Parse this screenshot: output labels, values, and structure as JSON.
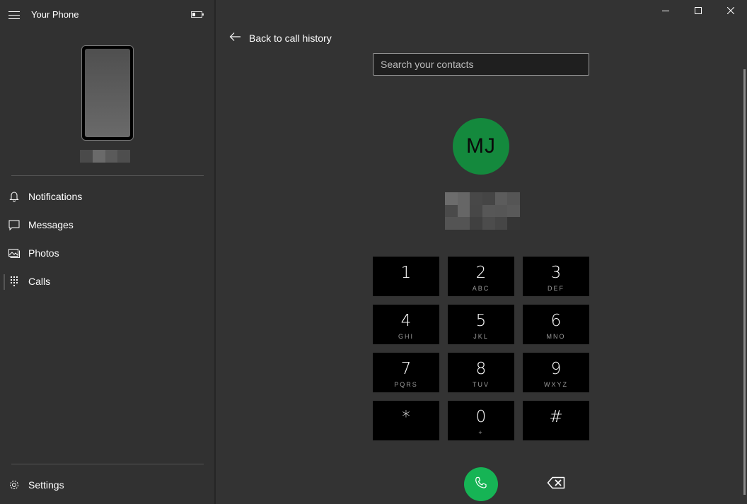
{
  "app": {
    "title": "Your Phone",
    "battery_level": 0.25
  },
  "sidebar": {
    "menu_icon": "hamburger-icon",
    "items": [
      {
        "label": "Notifications",
        "icon": "bell-icon",
        "active": false
      },
      {
        "label": "Messages",
        "icon": "chat-bubble-icon",
        "active": false
      },
      {
        "label": "Photos",
        "icon": "photos-icon",
        "active": false
      },
      {
        "label": "Calls",
        "icon": "dialpad-icon",
        "active": true
      }
    ],
    "settings": {
      "label": "Settings",
      "icon": "gear-icon"
    }
  },
  "window_controls": {
    "minimize": "minimize-icon",
    "maximize": "maximize-icon",
    "close": "close-icon"
  },
  "main": {
    "back_label": "Back to call history",
    "search_placeholder": "Search your contacts",
    "search_value": "",
    "contact_initials": "MJ",
    "avatar_color": "#14893d",
    "call_button_color": "#16b455",
    "dialpad": [
      {
        "digit": "1",
        "letters": ""
      },
      {
        "digit": "2",
        "letters": "ABC"
      },
      {
        "digit": "3",
        "letters": "DEF"
      },
      {
        "digit": "4",
        "letters": "GHI"
      },
      {
        "digit": "5",
        "letters": "JKL"
      },
      {
        "digit": "6",
        "letters": "MNO"
      },
      {
        "digit": "7",
        "letters": "PQRS"
      },
      {
        "digit": "8",
        "letters": "TUV"
      },
      {
        "digit": "9",
        "letters": "WXYZ"
      },
      {
        "digit": "*",
        "letters": ""
      },
      {
        "digit": "0",
        "letters": "+"
      },
      {
        "digit": "#",
        "letters": ""
      }
    ]
  }
}
